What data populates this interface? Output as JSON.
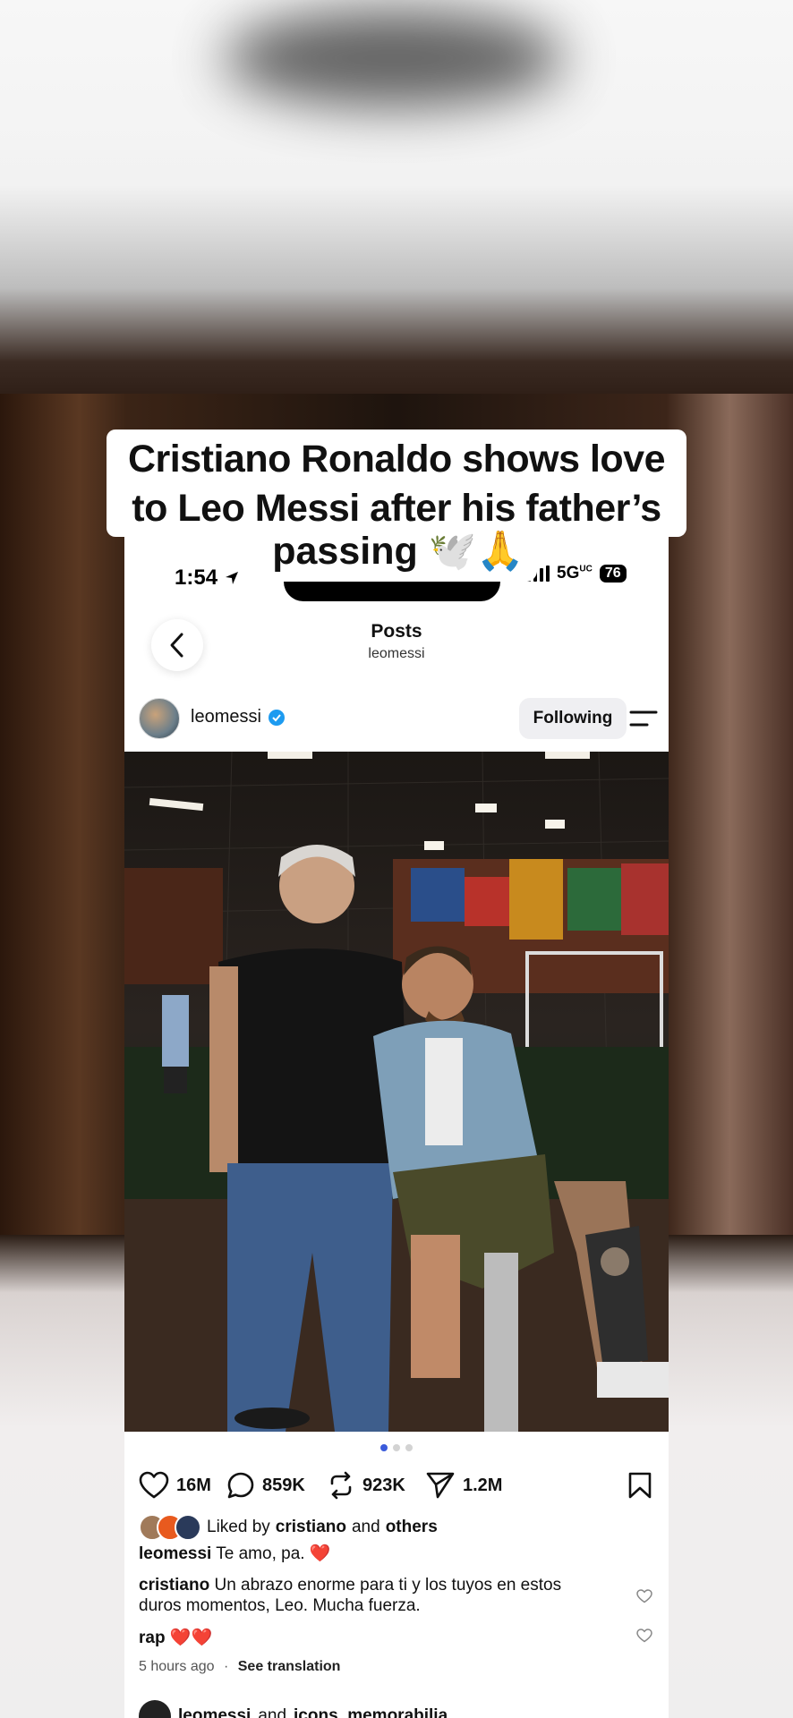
{
  "headline": {
    "line1": "Cristiano Ronaldo shows love",
    "line2": "to Leo Messi after his father’s",
    "line3": "passing 🕊️🙏"
  },
  "status": {
    "time": "1:54",
    "network": "5G",
    "network_suffix": "UC",
    "battery": "76"
  },
  "nav": {
    "title": "Posts",
    "subtitle": "leomessi"
  },
  "post": {
    "username": "leomessi",
    "follow_label": "Following",
    "carousel": {
      "count": 3,
      "active": 1
    },
    "actions": {
      "likes": "16M",
      "comments": "859K",
      "reposts": "923K",
      "shares": "1.2M"
    },
    "liked_by": {
      "prefix": "Liked by",
      "user": "cristiano",
      "joiner": "and",
      "others": "others"
    },
    "caption": {
      "user": "leomessi",
      "text": "Te amo, pa. ❤️"
    },
    "comments": [
      {
        "user": "cristiano",
        "text": "Un abrazo enorme para ti y los tuyos en estos duros momentos, Leo. Mucha fuerza."
      },
      {
        "user": "rap",
        "text": "❤️❤️"
      }
    ],
    "time_ago": "5 hours ago",
    "separator": "·",
    "see_translation": "See translation"
  },
  "next_post": {
    "user": "leomessi",
    "joiner": "and",
    "coauthor": "icons_memorabilia"
  },
  "icons": [
    "location-arrow-icon",
    "signal-icon",
    "back-chevron-icon",
    "verified-icon",
    "menu-icon",
    "heart-icon",
    "comment-icon",
    "repost-icon",
    "share-icon",
    "bookmark-icon"
  ]
}
